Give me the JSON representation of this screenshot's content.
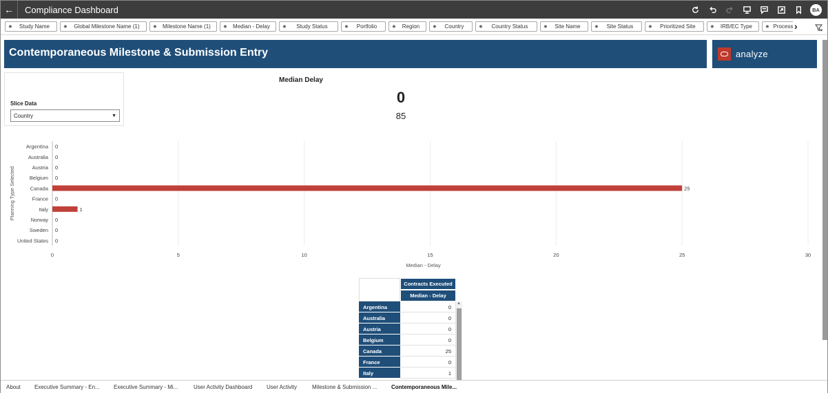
{
  "window": {
    "title": "Compliance Dashboard",
    "avatar": "BA"
  },
  "toolbar_icons": [
    "refresh-icon",
    "undo-icon",
    "redo-icon",
    "present-icon",
    "comment-icon",
    "export-icon",
    "bookmark-icon"
  ],
  "filters": [
    "Study Name",
    "Global Milestone Name (1)",
    "Milestone Name (1)",
    "Median - Delay",
    "Study Status",
    "Portfolio",
    "Region",
    "Country",
    "Country Status",
    "Site Name",
    "Site Status",
    "Prioritized Site",
    "IRB/EC Type",
    "Process N"
  ],
  "header": {
    "title": "Contemporaneous Milestone & Submission Entry",
    "brand": "analyze"
  },
  "slice": {
    "label": "Slice Data",
    "value": "Country"
  },
  "kpi": {
    "title": "Median Delay",
    "value": "0",
    "sub": "85"
  },
  "chart_data": {
    "type": "bar",
    "orientation": "horizontal",
    "categories": [
      "Argentina",
      "Australia",
      "Austria",
      "Belgium",
      "Canada",
      "France",
      "Italy",
      "Norway",
      "Sweden",
      "United States"
    ],
    "values": [
      0,
      0,
      0,
      0,
      25,
      0,
      1,
      0,
      0,
      0
    ],
    "xlabel": "Median - Delay",
    "ylabel": "Planning Type Selected",
    "xlim": [
      0,
      30
    ],
    "xticks": [
      0,
      5,
      10,
      15,
      20,
      25,
      30
    ],
    "grid": true,
    "bar_color": "#c0403a"
  },
  "table": {
    "header1": "Contracts Executed",
    "header2": "Median - Delay",
    "rows": [
      {
        "label": "Argentina",
        "value": "0"
      },
      {
        "label": "Australia",
        "value": "0"
      },
      {
        "label": "Austria",
        "value": "0"
      },
      {
        "label": "Belgium",
        "value": "0"
      },
      {
        "label": "Canada",
        "value": "25"
      },
      {
        "label": "France",
        "value": "0"
      },
      {
        "label": "Italy",
        "value": "1"
      }
    ]
  },
  "tabs": [
    {
      "label": "About",
      "active": false
    },
    {
      "label": "Executive Summary - En...",
      "active": false
    },
    {
      "label": "Executive Summary - Mi...",
      "active": false
    },
    {
      "label": "User Activity Dashboard",
      "active": false
    },
    {
      "label": "User Activity",
      "active": false
    },
    {
      "label": "Milestone & Submission ...",
      "active": false
    },
    {
      "label": "Contemporaneous Mile...",
      "active": true
    }
  ],
  "colors": {
    "header_bg": "#1f4e79",
    "brand_red": "#c0392b",
    "topbar": "#3d3d3d"
  }
}
